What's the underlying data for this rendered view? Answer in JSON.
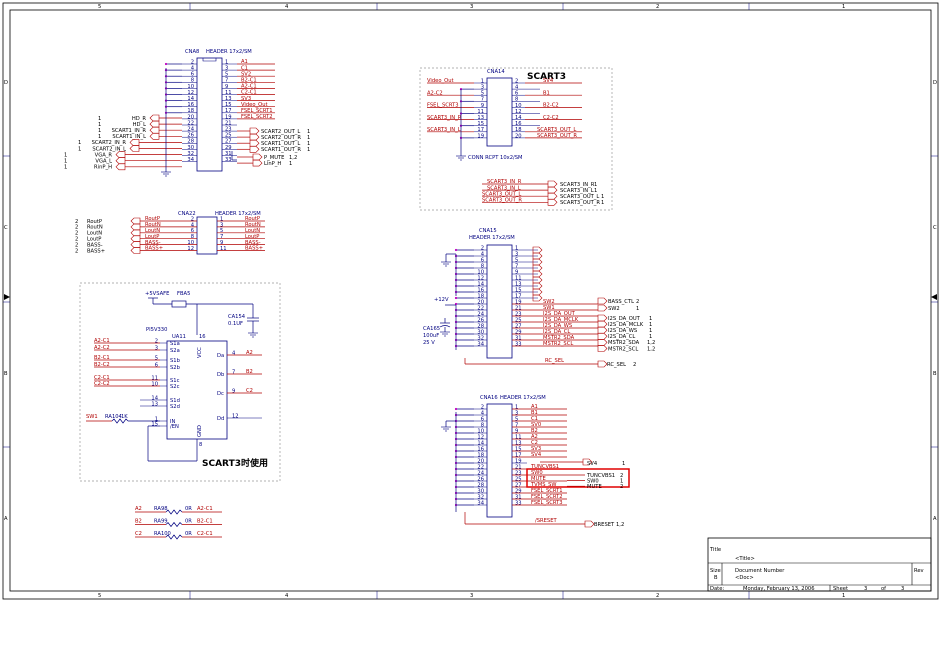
{
  "border": {
    "top_numbers": [
      "5",
      "4",
      "3",
      "2",
      "1"
    ],
    "bottom_numbers": [
      "5",
      "4",
      "3",
      "2",
      "1"
    ],
    "side_letters": [
      "D",
      "C",
      "B",
      "A"
    ]
  },
  "title_block": {
    "title_label": "Title",
    "title_value": "<Title>",
    "size_label": "Size",
    "size_value": "B",
    "docnum_label": "Document Number",
    "docnum_value": "<Doc>",
    "rev_label": "Rev",
    "date_label": "Date:",
    "date_value": "Monday, February 13, 2006",
    "sheet_label": "Sheet",
    "sheet_value": "3",
    "of_label": "of",
    "of_value": "3"
  },
  "cna8": {
    "title": "CNA8",
    "part": "HEADER 17x2/SM",
    "left_pins": [
      "2",
      "4",
      "6",
      "8",
      "10",
      "12",
      "14",
      "16",
      "18",
      "20",
      "22",
      "24",
      "26",
      "28",
      "30",
      "32",
      "34"
    ],
    "right_pins": [
      "1",
      "3",
      "5",
      "7",
      "9",
      "11",
      "13",
      "15",
      "17",
      "19",
      "21",
      "23",
      "25",
      "27",
      "29",
      "31",
      "33"
    ],
    "right_nets": [
      "A1",
      "C1",
      "SV2",
      "B2-C1",
      "A2-C1",
      "C2-C1",
      "SV3",
      "Video_Out",
      "FSEL_SCRT1",
      "FSEL_SCRT2",
      "",
      "",
      "",
      "",
      "",
      "",
      ""
    ],
    "left_ports": [
      {
        "idx": "1",
        "name": "HD_R"
      },
      {
        "idx": "1",
        "name": "HD_L"
      },
      {
        "idx": "1",
        "name": "SCART1_IN_R"
      },
      {
        "idx": "1",
        "name": "SCART1_IN_L"
      },
      {
        "idx": "1",
        "name": "SCART2_IN_R"
      },
      {
        "idx": "1",
        "name": "SCART2_IN_L"
      },
      {
        "idx": "1",
        "name": "VGA_R"
      },
      {
        "idx": "1",
        "name": "VGA_L"
      },
      {
        "idx": "1",
        "name": "RinP_H"
      }
    ],
    "right_ports": [
      {
        "name": "SCART2_OUT_L",
        "idx": "1"
      },
      {
        "name": "SCART2_OUT_R",
        "idx": "1"
      },
      {
        "name": "SCART1_OUT_L",
        "idx": "1"
      },
      {
        "name": "SCART1_OUT_R",
        "idx": "1"
      },
      {
        "name": "P_MUTE",
        "idx": "1,2"
      },
      {
        "name": "LinP_H",
        "idx": "1"
      }
    ]
  },
  "cna22": {
    "title": "CNA22",
    "part": "HEADER 17x2/SM",
    "left_pins": [
      "2",
      "4",
      "6",
      "8",
      "10",
      "12"
    ],
    "right_pins": [
      "1",
      "3",
      "5",
      "7",
      "9",
      "11"
    ],
    "left_nets": [
      "RoutP",
      "RoutN",
      "LoutN",
      "LoutP",
      "BASS-",
      "BASS+"
    ],
    "right_nets": [
      "RoutP",
      "RoutN",
      "LoutN",
      "LoutP",
      "BASS-",
      "BASS+"
    ],
    "ports": [
      {
        "idx": "2",
        "name": "RoutP"
      },
      {
        "idx": "2",
        "name": "RoutN"
      },
      {
        "idx": "2",
        "name": "LoutN"
      },
      {
        "idx": "2",
        "name": "LoutP"
      },
      {
        "idx": "2",
        "name": "BASS-"
      },
      {
        "idx": "2",
        "name": "BASS+"
      }
    ]
  },
  "scart3": {
    "heading": "SCART3",
    "title": "CNA14",
    "part": "CONN RCPT 10x2/SM",
    "left_pins": [
      "1",
      "3",
      "5",
      "7",
      "9",
      "11",
      "13",
      "15",
      "17",
      "19"
    ],
    "right_pins": [
      "2",
      "4",
      "6",
      "8",
      "10",
      "12",
      "14",
      "16",
      "18",
      "20"
    ],
    "left_nets": [
      "Video_Out",
      "",
      "A2-C2",
      "",
      "FSEL_SCRT3",
      "",
      "SCART3_IN_R",
      "",
      "SCART3_IN_L",
      ""
    ],
    "right_nets": [
      "SV4",
      "",
      "B1",
      "",
      "B2-C2",
      "",
      "C2-C2",
      "",
      "SCART3_OUT_L",
      "SCART3_OUT_R"
    ],
    "bus_nets": [
      "SCART3_IN_R",
      "SCART3_IN_L",
      "SCART3_OUT_L",
      "SCART3_OUT_R"
    ],
    "bus_ports": [
      {
        "name": "SCART3_IN_R",
        "idx": "1"
      },
      {
        "name": "SCART3_IN_L",
        "idx": "1"
      },
      {
        "name": "SCART3_OUT_L",
        "idx": "1"
      },
      {
        "name": "SCART3_OUT_R",
        "idx": "1"
      }
    ]
  },
  "cna15": {
    "title": "CNA15",
    "part": "HEADER 17x2/SM",
    "left_pins": [
      "2",
      "4",
      "6",
      "8",
      "10",
      "12",
      "14",
      "16",
      "18",
      "20",
      "22",
      "24",
      "26",
      "28",
      "30",
      "32",
      "34"
    ],
    "right_pins": [
      "1",
      "3",
      "5",
      "7",
      "9",
      "11",
      "13",
      "15",
      "17",
      "19",
      "21",
      "23",
      "25",
      "27",
      "29",
      "31",
      "33"
    ],
    "right_nets": [
      "",
      "",
      "",
      "",
      "",
      "",
      "",
      "",
      "",
      "SW2",
      "SW1",
      "I2S_DA_OUT",
      "I2S_DA_MCLK",
      "I2S_DA_WS",
      "I2S_DA_CL",
      "MSTR2_SDA",
      "MSTR2_SCL"
    ],
    "supply": "+12V",
    "cap_ref": "CA165",
    "cap_val": "100uF",
    "cap_v": "25 V",
    "ports": [
      {
        "name": "BASS_CTL",
        "idx": "2"
      },
      {
        "name": "SW2",
        "idx": "1"
      },
      {
        "name": "I2S_DA_OUT",
        "idx": "1"
      },
      {
        "name": "I2S_DA_MCLK",
        "idx": "1"
      },
      {
        "name": "I2S_DA_WS",
        "idx": "1"
      },
      {
        "name": "I2S_DA_CL",
        "idx": "1"
      },
      {
        "name": "MSTR2_SDA",
        "idx": "1,2"
      },
      {
        "name": "MSTR2_SCL",
        "idx": "1,2"
      }
    ],
    "rc_net": "RC_SEL",
    "rc_port": {
      "name": "RC_SEL",
      "idx": "2"
    }
  },
  "cna16": {
    "title": "CNA16",
    "part": "HEADER 17x2/SM",
    "left_pins": [
      "2",
      "4",
      "6",
      "8",
      "10",
      "12",
      "14",
      "16",
      "18",
      "20",
      "22",
      "24",
      "26",
      "28",
      "30",
      "32",
      "34"
    ],
    "right_pins": [
      "1",
      "3",
      "5",
      "7",
      "9",
      "11",
      "13",
      "15",
      "17",
      "19",
      "21",
      "23",
      "25",
      "27",
      "29",
      "31",
      "33"
    ],
    "right_nets": [
      "A1",
      "B1",
      "C1",
      "SV0",
      "B2",
      "A2",
      "C2",
      "SV3",
      "SV4",
      "",
      "TUNCVBS1",
      "SW0",
      "MUTE",
      "TVMS_SW",
      "FSEL_SCRT1",
      "FSEL_SCRT2",
      "FSEL_SCRT3"
    ],
    "sv4_port": {
      "name": "SV4",
      "idx": "1"
    },
    "highlight_ports": [
      {
        "name": "TUNCVBS1",
        "idx": "2"
      },
      {
        "name": "SW0",
        "idx": "1"
      },
      {
        "name": "MUTE",
        "idx": "2"
      }
    ],
    "reset_net": "/SRESET",
    "reset_port": {
      "name": "BRESET",
      "idx": "1,2"
    }
  },
  "switch_block": {
    "supply": "+5VSAFE",
    "bead": "FBA5",
    "cap_ref": "CA154",
    "cap_val": "0.1UF",
    "ic_part": "PI5V330",
    "ic_ref": "UA11",
    "vcc": "VCC",
    "gnd": "GND",
    "left_nets": [
      "A2-C1",
      "A2-C2",
      "B2-C1",
      "B2-C2",
      "C2-C1",
      "C2-C2"
    ],
    "ic_pins": [
      {
        "num": "2",
        "name": "S1a"
      },
      {
        "num": "3",
        "name": "S2a"
      },
      {
        "num": "5",
        "name": "S1b"
      },
      {
        "num": "6",
        "name": "S2b"
      },
      {
        "num": "11",
        "name": "S1c"
      },
      {
        "num": "10",
        "name": "S2c"
      },
      {
        "num": "14",
        "name": "S1d"
      },
      {
        "num": "13",
        "name": "S2d"
      },
      {
        "num": "1",
        "name": "IN"
      },
      {
        "num": "15",
        "name": "/EN"
      }
    ],
    "out_pins": [
      {
        "num": "4",
        "name": "Da",
        "net": "A2"
      },
      {
        "num": "7",
        "name": "Db",
        "net": "B2"
      },
      {
        "num": "9",
        "name": "Dc",
        "net": "C2"
      },
      {
        "num": "12",
        "name": "Dd",
        "net": ""
      }
    ],
    "vcc_pin": "16",
    "gnd_pin": "8",
    "sw_net": "SW1",
    "res_ref": "RA104",
    "res_val": "1K",
    "note": "SCART3时使用"
  },
  "resistors": [
    {
      "left": "A2",
      "ref": "RA98",
      "val": "0R",
      "right": "A2-C1"
    },
    {
      "left": "B2",
      "ref": "RA99",
      "val": "0R",
      "right": "B2-C1"
    },
    {
      "left": "C2",
      "ref": "RA100",
      "val": "0R",
      "right": "C2-C1"
    }
  ],
  "colors": {
    "net": "#b00000",
    "component": "#000080",
    "junction": "#c000c0",
    "highlight": "#e00000"
  }
}
